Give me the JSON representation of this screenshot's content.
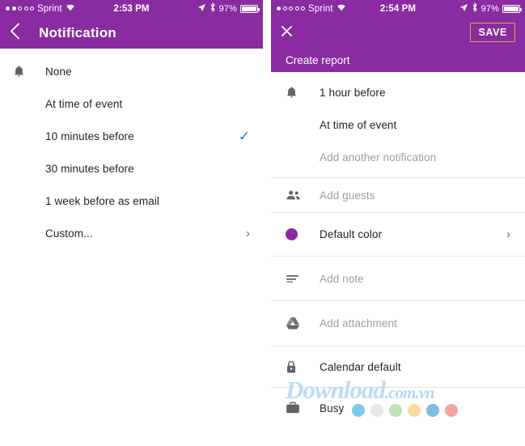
{
  "theme": {
    "purple": "#8a2ba2",
    "accent_gold": "#d8ad4e",
    "check_blue": "#2f6fd8",
    "muted_text": "#9aa0a6",
    "body_text": "#222426"
  },
  "left_screen": {
    "status_bar": {
      "carrier": "Sprint",
      "signal_dots_filled": 2,
      "signal_dots_total": 5,
      "wifi_icon": "wifi-icon",
      "time": "2:53 PM",
      "location_icon": "location-arrow-icon",
      "bluetooth_icon": "bluetooth-icon",
      "battery_percent": "97%"
    },
    "app_bar": {
      "back_icon": "chevron-left-icon",
      "title": "Notification"
    },
    "notification_icon": "bell-icon",
    "options": [
      {
        "label": "None",
        "selected": false,
        "trailing": ""
      },
      {
        "label": "At time of event",
        "selected": false,
        "trailing": ""
      },
      {
        "label": "10 minutes before",
        "selected": true,
        "trailing": "✓"
      },
      {
        "label": "30 minutes before",
        "selected": false,
        "trailing": ""
      },
      {
        "label": "1 week before as email",
        "selected": false,
        "trailing": ""
      },
      {
        "label": "Custom...",
        "selected": false,
        "trailing": "›"
      }
    ]
  },
  "right_screen": {
    "status_bar": {
      "carrier": "Sprint",
      "signal_dots_filled": 1,
      "signal_dots_total": 5,
      "wifi_icon": "wifi-icon",
      "time": "2:54 PM",
      "location_icon": "location-arrow-icon",
      "bluetooth_icon": "bluetooth-icon",
      "battery_percent": "97%"
    },
    "app_bar": {
      "close_icon": "close-icon",
      "save_label": "SAVE",
      "event_title": "Create report"
    },
    "notifications": {
      "icon": "bell-icon",
      "items": [
        {
          "label": "1 hour before",
          "muted": false
        },
        {
          "label": "At time of event",
          "muted": false
        },
        {
          "label": "Add another notification",
          "muted": true
        }
      ]
    },
    "rows": [
      {
        "icon": "people-icon",
        "label": "Add guests",
        "muted": true,
        "trailing": ""
      },
      {
        "icon": "color-dot-icon",
        "label": "Default color",
        "muted": false,
        "trailing": "›"
      },
      {
        "icon": "notes-icon",
        "label": "Add note",
        "muted": true,
        "trailing": ""
      },
      {
        "icon": "google-drive-icon",
        "label": "Add attachment",
        "muted": true,
        "trailing": ""
      },
      {
        "icon": "lock-icon",
        "label": "Calendar default",
        "muted": false,
        "trailing": ""
      },
      {
        "icon": "briefcase-icon",
        "label": "Busy",
        "muted": false,
        "trailing": ""
      }
    ]
  },
  "watermark": {
    "brand": "Download",
    "tld": ".com.vn",
    "dot_colors": [
      "#7ec9e8",
      "#e6e8ea",
      "#bfe3b4",
      "#fad9a0",
      "#7fbde0",
      "#f2a3a3"
    ]
  }
}
